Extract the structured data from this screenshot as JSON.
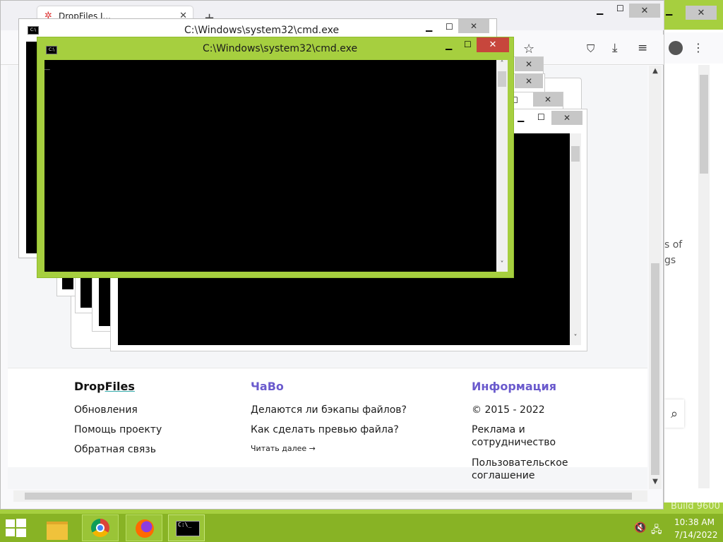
{
  "desktop": {
    "watermark_line": "Build 9600"
  },
  "browser": {
    "tab_title": "DropFiles I...",
    "new_tab_icon": "plus-icon",
    "right_page_text_1": "s of",
    "right_page_text_2": "gs",
    "footer": {
      "col1": {
        "title_drop": "Drop",
        "title_files": "Files",
        "links": [
          "Обновления",
          "Помощь проекту",
          "Обратная связь"
        ]
      },
      "col2": {
        "title": "ЧаВо",
        "links": [
          "Делаются ли бэкапы файлов?",
          "Как сделать превью файла?"
        ],
        "more": "Читать далее →"
      },
      "col3": {
        "title": "Информация",
        "copyright": "© 2015 - 2022",
        "ad_line1": "Реклама и",
        "ad_line2": "сотрудничество",
        "terms_line1": "Пользовательское",
        "terms_line2": "соглашение"
      }
    },
    "colors": {
      "accent": "#6a5acd",
      "text": "#1a1a1a"
    }
  },
  "cmd_back": {
    "title": "C:\\Windows\\system32\\cmd.exe"
  },
  "cmd_front": {
    "title": "C:\\Windows\\system32\\cmd.exe",
    "cursor": "_"
  },
  "taskbar": {
    "time": "10:38 AM",
    "date": "7/14/2022",
    "apps": [
      "windows-start",
      "file-explorer",
      "chrome",
      "firefox",
      "cmd"
    ]
  }
}
